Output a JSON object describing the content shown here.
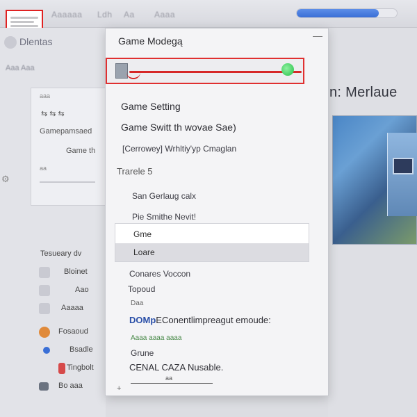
{
  "topbar": {
    "blur_labels": [
      "Aaaaaa",
      "Ldh",
      "Aa",
      "Aaaa"
    ],
    "progress": 0.82,
    "accent": "#3a6fd6"
  },
  "left_panel": {
    "title": "Dlentas",
    "crumb": "Aaa  Aaa",
    "card": {
      "label_1": "Gamepamsaed",
      "label_2": "Game th",
      "tiny_1": "aaa",
      "tiny_2": "aa"
    },
    "list": [
      {
        "label": "Tesueary dv",
        "icon_color": ""
      },
      {
        "label": "Bloinet",
        "icon_color": "#c9cad2"
      },
      {
        "label": "Aao",
        "icon_color": "#c9cad2"
      },
      {
        "label": "Aaaaa",
        "icon_color": "#c9cad2"
      },
      {
        "label": "Fosaoud",
        "icon_color": "#e08a3a"
      },
      {
        "label": "Bsadle",
        "icon_color": "#3a6fd6"
      },
      {
        "label": "Tingbolt",
        "icon_color": "#d64a4a"
      },
      {
        "label": "Bo aaa",
        "icon_color": "#6b7380"
      }
    ]
  },
  "right_panel": {
    "heading": "n:  Merlaue"
  },
  "menu": {
    "title": "Game Modegą",
    "close_icon": "minus-icon",
    "slider": {
      "value": 0.92,
      "track_color": "#d62828",
      "knob_color": "#22c046"
    },
    "items": {
      "game_setting": "Game Setting",
      "game_switch": "Game Switt th wovae Sae)",
      "remove": "[Cerrowey] Wrhltiy'yp Cmaglan",
      "section_label": "Trarele 5",
      "san": "San   Gerlaug calx",
      "pic": "Pie Smithe Nevit!",
      "option_1": "Gme",
      "option_2": "Loare",
      "consensus": "Conares Voccon",
      "topoud": "Topoud",
      "tiny": "Daa",
      "blue_prefix": "DOMp",
      "blue_rest": "EConentlimpreagut emoude:",
      "green_small": "Aaaa  aaaa  aaaa",
      "grune": "Grune",
      "cenal": "CENAL CAZA  Nusable.",
      "bottom_tiny": "aa"
    }
  }
}
